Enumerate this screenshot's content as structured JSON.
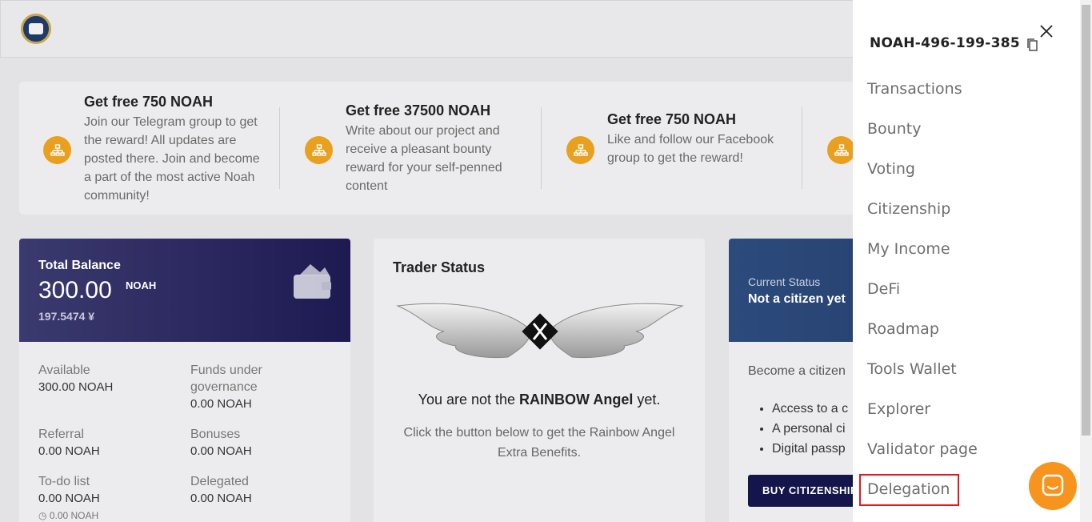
{
  "promos": [
    {
      "title": "Get free 750 NOAH",
      "text": "Join our Telegram group to get the reward! All updates are posted there. Join and become a part of the most active Noah community!"
    },
    {
      "title": "Get free 37500 NOAH",
      "text": "Write about our project and receive a pleasant bounty reward for your self-penned content"
    },
    {
      "title": "Get free 750 NOAH",
      "text": "Like and follow our Facebook group to get the reward!"
    }
  ],
  "balance": {
    "label": "Total Balance",
    "amount": "300.00",
    "unit": "NOAH",
    "sub": "197.5474 ¥",
    "fields": [
      {
        "label": "Available",
        "value": "300.00 NOAH"
      },
      {
        "label": "Funds under governance",
        "value": "0.00 NOAH"
      },
      {
        "label": "Referral",
        "value": "0.00 NOAH"
      },
      {
        "label": "Bonuses",
        "value": "0.00 NOAH"
      },
      {
        "label": "To-do list",
        "value": "0.00 NOAH"
      },
      {
        "label": "Delegated",
        "value": "0.00 NOAH"
      }
    ],
    "note": "0.00 NOAH"
  },
  "trader": {
    "title": "Trader Status",
    "line_prefix": "You are not the ",
    "line_bold": "RAINBOW Angel",
    "line_suffix": " yet.",
    "sub": "Click the button below to get the Rainbow Angel Extra Benefits."
  },
  "citizenship": {
    "label": "Current Status",
    "value": "Not a citizen yet",
    "intro": "Become a citizen",
    "benefits": [
      "Access to a c",
      "A personal ci",
      "Digital passp"
    ],
    "button": "BUY CITIZENSHIP"
  },
  "drawer": {
    "account_id": "NOAH-496-199-385",
    "menu": [
      "Transactions",
      "Bounty",
      "Voting",
      "Citizenship",
      "My Income",
      "DeFi",
      "Roadmap",
      "Tools Wallet",
      "Explorer",
      "Validator page",
      "Delegation"
    ],
    "highlighted": "Delegation"
  },
  "colors": {
    "accent_orange": "#f7941e",
    "highlight_red": "#e3181f",
    "balance_header": "#1d1a52",
    "button_navy": "#14154a"
  },
  "icons": [
    "close-icon",
    "copy-icon",
    "wallet-icon",
    "sitemap-icon",
    "chat-icon",
    "clock-icon"
  ]
}
